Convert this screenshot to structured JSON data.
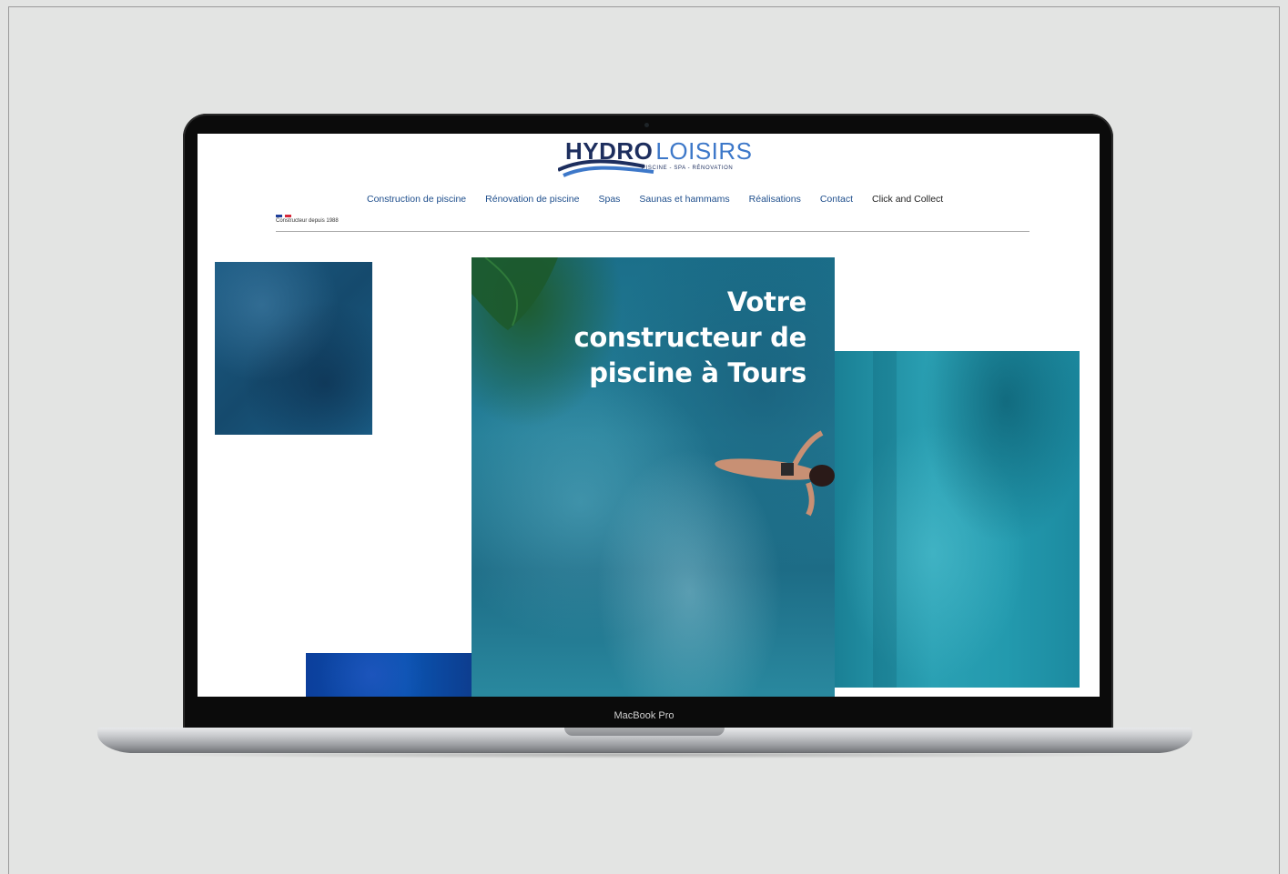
{
  "device": {
    "label": "MacBook Pro"
  },
  "site": {
    "logo": {
      "hydro": "HYDRO",
      "loisirs": "LOISIRS",
      "tagline": "PISCINE - SPA - RÉNOVATION"
    },
    "nav": [
      "Construction de piscine",
      "Rénovation de piscine",
      "Spas",
      "Saunas et hammams",
      "Réalisations",
      "Contact",
      "Click and Collect"
    ],
    "since_label": "Constructeur depuis 1988",
    "hero_title": "Votre constructeur de piscine à Tours"
  },
  "colors": {
    "brand_navy": "#1d2e5e",
    "brand_blue": "#3d78c9",
    "nav_link": "#1e4e8c",
    "flag_blue": "#1f3f9a",
    "flag_red": "#d8293b"
  }
}
